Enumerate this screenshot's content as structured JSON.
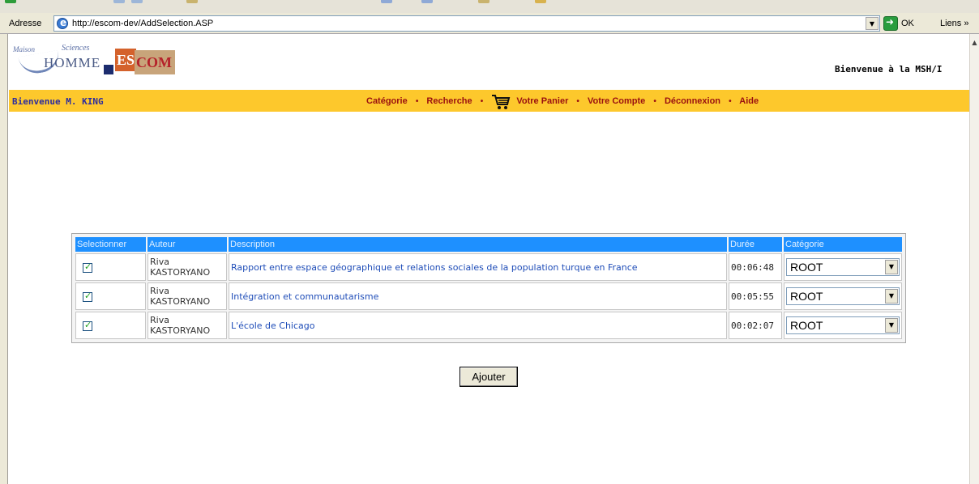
{
  "browser": {
    "address_label": "Adresse",
    "url": "http://escom-dev/AddSelection.ASP",
    "go_label": "OK",
    "links_label": "Liens »"
  },
  "header": {
    "logo_maison": "Maison",
    "logo_sciences": "Sciences",
    "logo_homme": "HOMME",
    "logo_escom_left": "ES",
    "logo_escom_right": "COM",
    "welcome_site": "Bienvenue à la MSH/I"
  },
  "menubar": {
    "welcome_user": "Bienvenue M. KING",
    "items": [
      "Catégorie",
      "Recherche",
      "Votre Panier",
      "Votre Compte",
      "Déconnexion",
      "Aide"
    ],
    "separator": "•",
    "colors": {
      "background": "#fdc82c",
      "item": "#9a1010",
      "user": "#2d2d9e"
    }
  },
  "table": {
    "columns": [
      "Selectionner",
      "Auteur",
      "Description",
      "Durée",
      "Catégorie"
    ],
    "header_color": "#1e90ff",
    "rows": [
      {
        "checked": true,
        "author_first": "Riva",
        "author_last": "KASTORYANO",
        "description": "Rapport entre espace géographique et relations sociales de la population turque en France",
        "duration": "00:06:48",
        "category": "ROOT"
      },
      {
        "checked": true,
        "author_first": "Riva",
        "author_last": "KASTORYANO",
        "description": "Intégration et communautarisme",
        "duration": "00:05:55",
        "category": "ROOT"
      },
      {
        "checked": true,
        "author_first": "Riva",
        "author_last": "KASTORYANO",
        "description": "L'école de Chicago",
        "duration": "00:02:07",
        "category": "ROOT"
      }
    ]
  },
  "actions": {
    "add_label": "Ajouter"
  },
  "icons": [
    "ie-page-icon",
    "go-arrow-icon",
    "cart-icon",
    "dropdown-arrow-icon",
    "checkbox-checked-icon"
  ]
}
